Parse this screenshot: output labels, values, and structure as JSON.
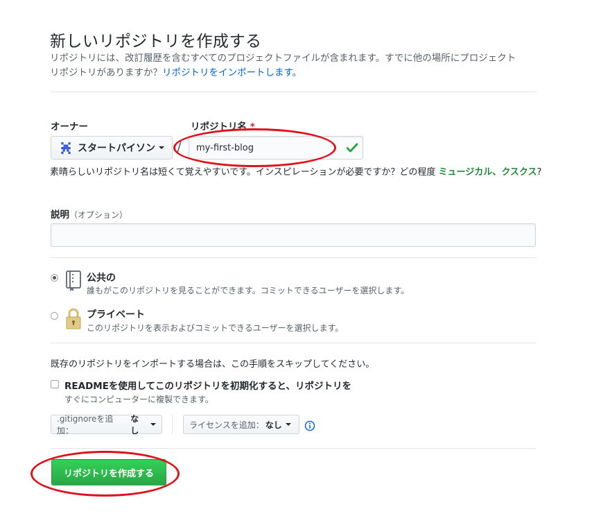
{
  "header": {
    "title": "新しいリポジトリを作成する",
    "subtitle_line1": "リポジトリには、改訂履歴を含むすべてのプロジェクトファイルが含まれます。すでに他の場所にプロジェクト",
    "subtitle_line2": "リポジトリがありますか？",
    "import_link": "リポジトリをインポートします。"
  },
  "form": {
    "owner_label": "オーナー",
    "owner_value": "スタートパイソン",
    "repo_label": "リポジトリ名",
    "required_mark": "*",
    "separator": "/",
    "repo_value": "my-first-blog",
    "hint_text": "素晴らしいリポジトリ名は短くて覚えやすいです。インスピレーションが必要ですか？どの程度",
    "hint_suggestion1": "ミュージカル",
    "hint_comma": "、",
    "hint_suggestion2": "クスクス",
    "hint_end": "?",
    "description_label": "説明",
    "description_optional": "（オプション）",
    "description_value": ""
  },
  "visibility": {
    "public": {
      "title": "公共の",
      "desc": "誰もがこのリポジトリを見ることができます。コミットできるユーザーを選択します。",
      "checked": true
    },
    "private": {
      "title": "プライベート",
      "desc": "このリポジトリを表示およびコミットできるユーザーを選択します。",
      "checked": false
    }
  },
  "init": {
    "skip_text": "既存のリポジトリをインポートする場合は、この手順をスキップしてください。",
    "readme_label": "READMEを使用してこのリポジトリを初期化すると、リポジトリを",
    "readme_sub": "すぐにコンピューターに複製できます。",
    "readme_checked": false,
    "gitignore_label": ".gitignoreを追加：",
    "gitignore_value": "なし",
    "license_label": "ライセンスを追加：",
    "license_value": "なし"
  },
  "actions": {
    "create_label": "リポジトリを作成する"
  },
  "colors": {
    "accent_link": "#0366d6",
    "success_green": "#28a745",
    "annotation_red": "#e0101a"
  }
}
